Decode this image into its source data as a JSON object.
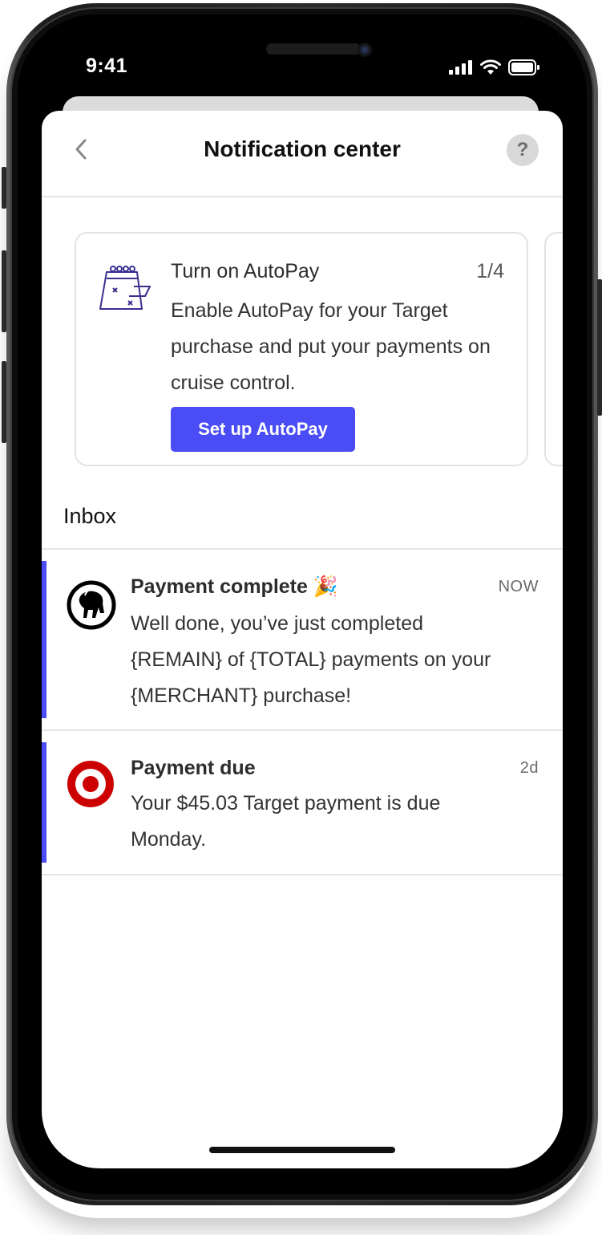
{
  "status_bar": {
    "time": "9:41"
  },
  "header": {
    "title": "Notification center",
    "help_label": "?"
  },
  "promo_card": {
    "title": "Turn on AutoPay",
    "counter": "1/4",
    "body": "Enable AutoPay for your Target purchase and put your payments on cruise control.",
    "button_label": "Set up AutoPay",
    "icon": "calendar-autopay-icon"
  },
  "inbox": {
    "title": "Inbox",
    "items": [
      {
        "title": "Payment complete",
        "emoji": "🎉",
        "time": "NOW",
        "body": "Well done, you’ve just completed {REMAIN} of {TOTAL} payments on your {MERCHANT} purchase!",
        "icon": "goat-logo-icon"
      },
      {
        "title": "Payment due",
        "time": "2d",
        "body": "Your $45.03 Target payment is due Monday.",
        "icon": "target-logo-icon"
      }
    ]
  },
  "colors": {
    "accent": "#4a4cf5",
    "target_red": "#cc0000"
  }
}
